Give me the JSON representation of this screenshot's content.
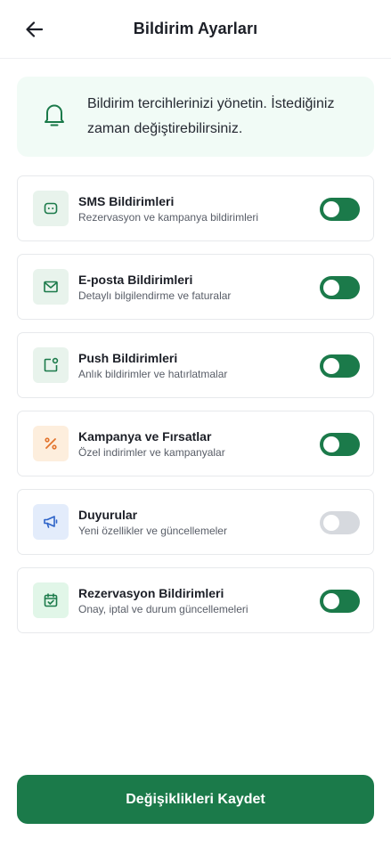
{
  "header": {
    "title": "Bildirim Ayarları",
    "back_icon": "arrow-left-icon"
  },
  "info": {
    "icon": "bell-icon",
    "text": "Bildirim tercihlerinizi yönetin. İstediğiniz zaman değiştirebilirsiniz."
  },
  "settings": [
    {
      "title": "SMS Bildirimleri",
      "subtitle": "Rezervasyon ve kampanya bildirimleri",
      "icon": "message-square-icon",
      "enabled": true,
      "icon_bg": "#e8f3ec",
      "icon_color": "#1b7a4a"
    },
    {
      "title": "E-posta Bildirimleri",
      "subtitle": "Detaylı bilgilendirme ve faturalar",
      "icon": "mail-icon",
      "enabled": true,
      "icon_bg": "#e8f3ec",
      "icon_color": "#1b7a4a"
    },
    {
      "title": "Push Bildirimleri",
      "subtitle": "Anlık bildirimler ve hatırlatmalar",
      "icon": "app-notification-icon",
      "enabled": true,
      "icon_bg": "#e8f3ec",
      "icon_color": "#1b7a4a"
    },
    {
      "title": "Kampanya ve Fırsatlar",
      "subtitle": "Özel indirimler ve kampanyalar",
      "icon": "percent-icon",
      "enabled": true,
      "icon_bg": "#fdeedd",
      "icon_color": "#e2742d"
    },
    {
      "title": "Duyurular",
      "subtitle": "Yeni özellikler ve güncellemeler",
      "icon": "megaphone-icon",
      "enabled": false,
      "icon_bg": "#e3ecfb",
      "icon_color": "#2d63c8"
    },
    {
      "title": "Rezervasyon Bildirimleri",
      "subtitle": "Onay, iptal ve durum güncellemeleri",
      "icon": "calendar-check-icon",
      "enabled": true,
      "icon_bg": "#e1f6e8",
      "icon_color": "#1b7a4a"
    }
  ],
  "save_button": {
    "label": "Değişiklikleri Kaydet"
  },
  "colors": {
    "accent": "#1b7a4a",
    "toggle_off": "#d6d9de",
    "info_bg": "#f1fbf6"
  }
}
